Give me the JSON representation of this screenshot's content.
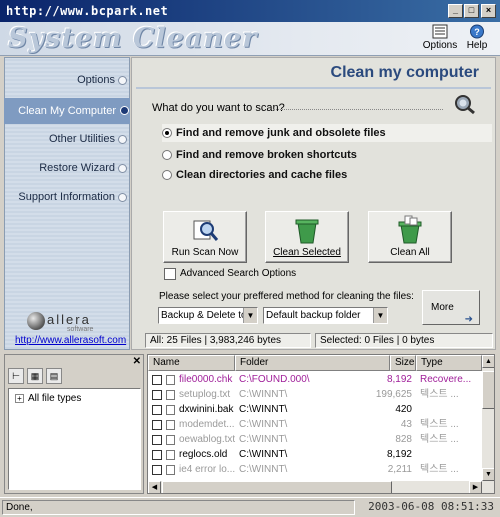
{
  "titlebar": {
    "url": "http://www.bcpark.net"
  },
  "header": {
    "logo": "System Cleaner",
    "options_label": "Options",
    "help_label": "Help"
  },
  "nav": {
    "items": [
      {
        "label": "Options",
        "active": false
      },
      {
        "label": "Clean My Computer",
        "active": true
      },
      {
        "label": "Other Utilities",
        "active": false
      },
      {
        "label": "Restore Wizard",
        "active": false
      },
      {
        "label": "Support Information",
        "active": false
      }
    ],
    "brand": "allera",
    "brand_sub": "software",
    "link": "http://www.allerasoft.com"
  },
  "main": {
    "title": "Clean my computer",
    "question": "What do you want to scan?",
    "options": [
      "Find and remove junk and obsolete files",
      "Find and remove broken shortcuts",
      "Clean directories and cache files"
    ],
    "buttons": {
      "scan": "Run Scan Now",
      "clean_selected": "Clean Selected",
      "clean_all": "Clean All"
    },
    "advanced": "Advanced Search Options",
    "method_label": "Please select your preffered method for cleaning the files:",
    "method_value": "Backup & Delete to",
    "folder_value": "Default backup folder",
    "more": "More"
  },
  "status": {
    "all": "All: 25 Files | 3,983,246 bytes",
    "selected": "Selected: 0 Files | 0 bytes"
  },
  "tree": {
    "root": "All file types"
  },
  "list": {
    "headers": [
      "Name",
      "Folder",
      "Size",
      "Type"
    ],
    "rows": [
      {
        "name": "file0000.chk",
        "folder": "C:\\FOUND.000\\",
        "size": "8,192",
        "type": "Recovere..."
      },
      {
        "name": "setuplog.txt",
        "folder": "C:\\WINNT\\",
        "size": "199,625",
        "type": "텍스트 ..."
      },
      {
        "name": "dxwinini.bak",
        "folder": "C:\\WINNT\\",
        "size": "420",
        "type": ""
      },
      {
        "name": "modemdet....",
        "folder": "C:\\WINNT\\",
        "size": "43",
        "type": "텍스트 ..."
      },
      {
        "name": "oewablog.txt",
        "folder": "C:\\WINNT\\",
        "size": "828",
        "type": "텍스트 ..."
      },
      {
        "name": "reglocs.old",
        "folder": "C:\\WINNT\\",
        "size": "8,192",
        "type": ""
      },
      {
        "name": "ie4 error lo...",
        "folder": "C:\\WINNT\\",
        "size": "2,211",
        "type": "텍스트 ..."
      }
    ]
  },
  "statusbar": {
    "left": "Done,",
    "right": "2003-06-08 08:51:33"
  },
  "colors": {
    "accent": "#2b4a7e",
    "nav_active": "#7f9bc1",
    "recovered_file": "#a0209a",
    "muted_file": "#9a9a9a"
  }
}
